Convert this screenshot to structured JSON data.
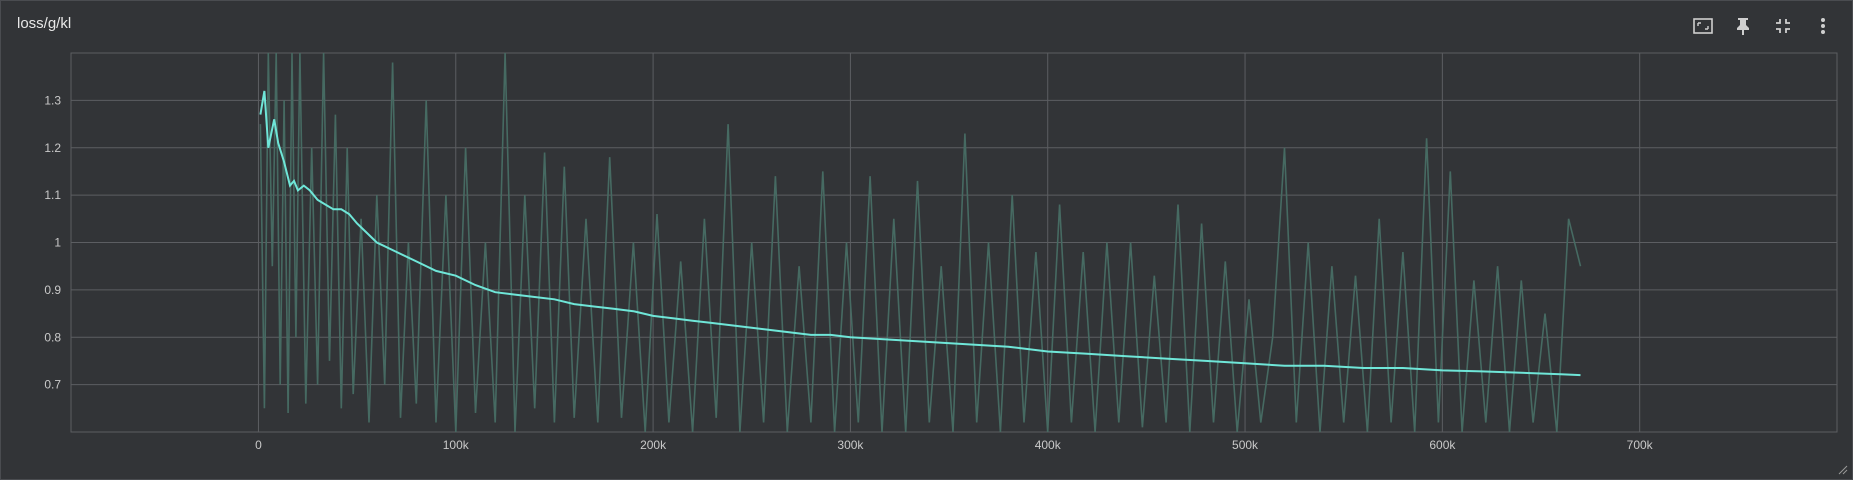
{
  "panel": {
    "title": "loss/g/kl"
  },
  "toolbar": {
    "icons": [
      "fit-domain-icon",
      "pin-icon",
      "collapse-icon",
      "more-vert-icon"
    ]
  },
  "colors": {
    "background": "#323437",
    "grid": "#5c5e62",
    "raw_series": "#466a62",
    "smoothed_series": "#6fe6d8",
    "tick_text": "#c9c9c9"
  },
  "chart_data": {
    "type": "line",
    "title": "loss/g/kl",
    "xlabel": "",
    "ylabel": "",
    "xlim": [
      -95000,
      800000
    ],
    "ylim": [
      0.6,
      1.4
    ],
    "x_ticks": [
      0,
      100000,
      200000,
      300000,
      400000,
      500000,
      600000,
      700000
    ],
    "x_tick_labels": [
      "0",
      "100k",
      "200k",
      "300k",
      "400k",
      "500k",
      "600k",
      "700k"
    ],
    "y_ticks": [
      0.7,
      0.8,
      0.9,
      1.0,
      1.1,
      1.2,
      1.3
    ],
    "y_tick_labels": [
      "0.7",
      "0.8",
      "0.9",
      "1",
      "1.1",
      "1.2",
      "1.3"
    ],
    "grid": true,
    "series": [
      {
        "role": "smoothed",
        "x": [
          1000,
          3000,
          5000,
          8000,
          10000,
          13000,
          16000,
          18000,
          20000,
          23000,
          26000,
          30000,
          34000,
          38000,
          42000,
          46000,
          50000,
          55000,
          60000,
          70000,
          80000,
          90000,
          100000,
          110000,
          120000,
          130000,
          140000,
          150000,
          160000,
          170000,
          180000,
          190000,
          200000,
          210000,
          220000,
          230000,
          240000,
          250000,
          260000,
          270000,
          280000,
          290000,
          300000,
          320000,
          340000,
          360000,
          380000,
          400000,
          420000,
          440000,
          460000,
          480000,
          500000,
          520000,
          540000,
          560000,
          580000,
          600000,
          620000,
          640000,
          660000,
          670000
        ],
        "values": [
          1.27,
          1.32,
          1.2,
          1.26,
          1.21,
          1.17,
          1.12,
          1.13,
          1.11,
          1.12,
          1.11,
          1.09,
          1.08,
          1.07,
          1.07,
          1.06,
          1.04,
          1.02,
          1.0,
          0.98,
          0.96,
          0.94,
          0.93,
          0.91,
          0.895,
          0.89,
          0.885,
          0.88,
          0.87,
          0.865,
          0.86,
          0.855,
          0.845,
          0.84,
          0.835,
          0.83,
          0.825,
          0.82,
          0.815,
          0.81,
          0.805,
          0.805,
          0.8,
          0.795,
          0.79,
          0.785,
          0.78,
          0.77,
          0.765,
          0.76,
          0.755,
          0.75,
          0.745,
          0.74,
          0.74,
          0.735,
          0.735,
          0.73,
          0.728,
          0.725,
          0.722,
          0.72
        ]
      },
      {
        "role": "raw",
        "x": [
          1000,
          3000,
          5000,
          7000,
          9000,
          11000,
          13000,
          15000,
          17000,
          19000,
          21000,
          24000,
          27000,
          30000,
          33000,
          36000,
          39000,
          42000,
          45000,
          48000,
          52000,
          56000,
          60000,
          64000,
          68000,
          72000,
          76000,
          80000,
          85000,
          90000,
          95000,
          100000,
          105000,
          110000,
          115000,
          120000,
          125000,
          130000,
          135000,
          140000,
          145000,
          150000,
          155000,
          160000,
          166000,
          172000,
          178000,
          184000,
          190000,
          196000,
          202000,
          208000,
          214000,
          220000,
          226000,
          232000,
          238000,
          244000,
          250000,
          256000,
          262000,
          268000,
          274000,
          280000,
          286000,
          292000,
          298000,
          304000,
          310000,
          316000,
          322000,
          328000,
          334000,
          340000,
          346000,
          352000,
          358000,
          364000,
          370000,
          376000,
          382000,
          388000,
          394000,
          400000,
          406000,
          412000,
          418000,
          424000,
          430000,
          436000,
          442000,
          448000,
          454000,
          460000,
          466000,
          472000,
          478000,
          484000,
          490000,
          496000,
          502000,
          508000,
          514000,
          520000,
          526000,
          532000,
          538000,
          544000,
          550000,
          556000,
          562000,
          568000,
          574000,
          580000,
          586000,
          592000,
          598000,
          604000,
          610000,
          616000,
          622000,
          628000,
          634000,
          640000,
          646000,
          652000,
          658000,
          664000,
          670000
        ],
        "values": [
          1.25,
          0.65,
          1.4,
          0.95,
          1.4,
          0.7,
          1.3,
          0.64,
          1.4,
          0.8,
          1.4,
          0.66,
          1.2,
          0.7,
          1.4,
          0.75,
          1.27,
          0.65,
          1.2,
          0.68,
          1.05,
          0.62,
          1.1,
          0.7,
          1.38,
          0.63,
          1.0,
          0.66,
          1.3,
          0.62,
          1.1,
          0.6,
          1.2,
          0.64,
          1.0,
          0.62,
          1.4,
          0.6,
          1.1,
          0.65,
          1.19,
          0.62,
          1.16,
          0.63,
          1.05,
          0.62,
          1.18,
          0.63,
          1.0,
          0.6,
          1.06,
          0.62,
          0.96,
          0.6,
          1.05,
          0.63,
          1.25,
          0.6,
          1.0,
          0.62,
          1.14,
          0.6,
          0.95,
          0.62,
          1.15,
          0.6,
          1.0,
          0.62,
          1.14,
          0.6,
          1.05,
          0.6,
          1.13,
          0.62,
          0.95,
          0.6,
          1.23,
          0.62,
          1.0,
          0.6,
          1.1,
          0.62,
          0.98,
          0.6,
          1.08,
          0.62,
          0.98,
          0.6,
          1.0,
          0.62,
          1.0,
          0.61,
          0.93,
          0.62,
          1.08,
          0.6,
          1.04,
          0.62,
          0.96,
          0.6,
          0.88,
          0.62,
          0.8,
          1.2,
          0.62,
          1.0,
          0.6,
          0.95,
          0.62,
          0.93,
          0.6,
          1.05,
          0.62,
          0.98,
          0.6,
          1.22,
          0.62,
          1.15,
          0.6,
          0.92,
          0.62,
          0.95,
          0.6,
          0.92,
          0.62,
          0.85,
          0.6,
          1.05,
          0.95
        ]
      }
    ]
  }
}
